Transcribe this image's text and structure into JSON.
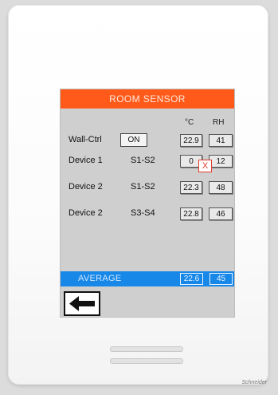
{
  "screen": {
    "title": "ROOM SENSOR",
    "col_temp": "°C",
    "col_rh": "RH",
    "rows": [
      {
        "label": "Wall-Ctrl",
        "mode": "ON",
        "temp": "22.9",
        "rh": "41"
      },
      {
        "label": "Device 1",
        "mode": "S1-S2",
        "temp": "0",
        "rh": "12",
        "error": "X"
      },
      {
        "label": "Device 2",
        "mode": "S1-S2",
        "temp": "22.3",
        "rh": "48"
      },
      {
        "label": "Device 2",
        "mode": "S3-S4",
        "temp": "22.8",
        "rh": "46"
      }
    ],
    "average": {
      "label": "AVERAGE",
      "temp": "22.6",
      "rh": "45"
    },
    "back_icon": "arrow-left-icon"
  },
  "colors": {
    "header": "#ff5a1a",
    "average_bar": "#1888e8",
    "screen_bg": "#cfcfcf",
    "error": "#e23a2a"
  },
  "brand": {
    "text": "Schneider"
  }
}
